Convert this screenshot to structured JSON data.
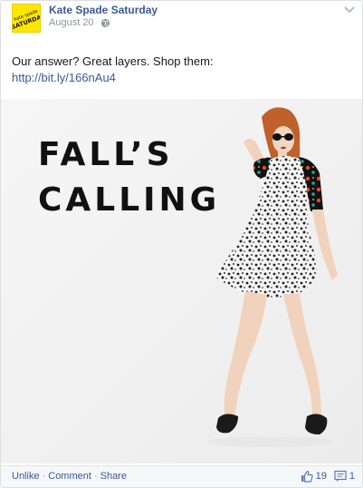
{
  "post": {
    "author": "Kate Spade Saturday",
    "avatar_text": "kate spade SATURDAY",
    "date": "August 20",
    "message_text": "Our answer? Great layers. Shop them:",
    "link": "http://bit.ly/166nAu4",
    "photo": {
      "headline_line1": "FALL’S",
      "headline_line2": "CALLING"
    },
    "actions": {
      "unlike": "Unlike",
      "comment": "Comment",
      "share": "Share",
      "separator": "·"
    },
    "counts": {
      "likes": "19",
      "comments": "1"
    },
    "icons": {
      "privacy": "globe-icon",
      "options": "chevron-down-icon",
      "like": "thumbs-up-icon",
      "comment": "comment-icon"
    },
    "colors": {
      "link": "#3b5998",
      "avatar_bg": "#ffe600",
      "text": "#141823",
      "muted": "#90949c"
    }
  }
}
